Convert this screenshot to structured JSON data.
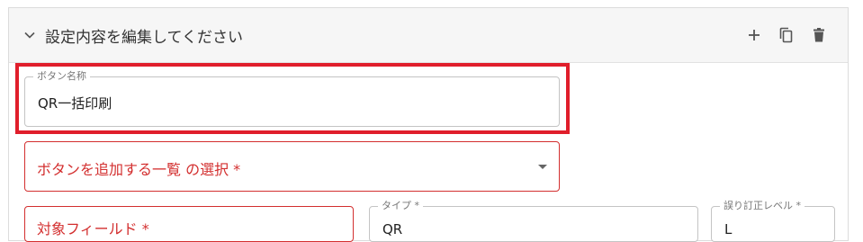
{
  "panel": {
    "title": "設定内容を編集してください",
    "icons": [
      "chevron-down-icon",
      "plus-icon",
      "copy-icon",
      "trash-icon"
    ]
  },
  "button_name_field": {
    "label": "ボタン名称",
    "value": "QR一括印刷"
  },
  "select_field": {
    "placeholder": "ボタンを追加する一覧 の選択 *"
  },
  "target_field": {
    "text": "対象フィールド *"
  },
  "type_field": {
    "label": "タイプ *",
    "value": "QR"
  },
  "ecc_field": {
    "label": "誤り訂正レベル *",
    "value": "L"
  },
  "colors": {
    "highlight": "#e01e2b",
    "error": "#d32f2f",
    "header_bg": "#f6f6f6"
  }
}
